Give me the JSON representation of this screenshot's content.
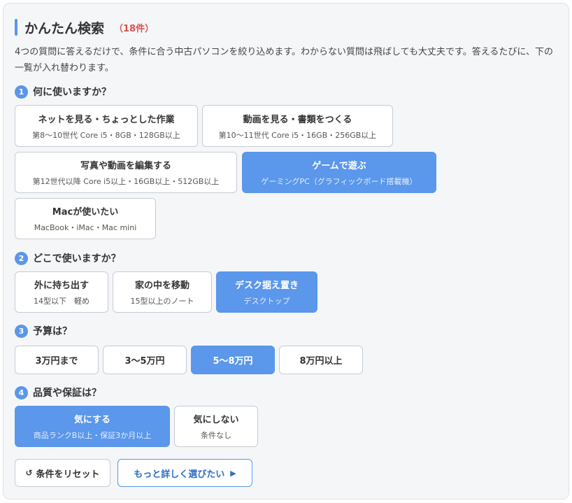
{
  "header": {
    "title": "かんたん検索",
    "count": "（18件）"
  },
  "description": "4つの質問に答えるだけで、条件に合う中古パソコンを絞り込めます。わからない質問は飛ばしても大丈夫です。答えるたびに、下の一覧が入れ替わります。",
  "questions": [
    {
      "num": "1",
      "label": "何に使いますか？",
      "options": [
        {
          "main": "ネットを見る・ちょっとした作業",
          "sub": "第8〜10世代 Core i5・8GB・128GB以上",
          "selected": false
        },
        {
          "main": "動画を見る・書類をつくる",
          "sub": "第10〜11世代 Core i5・16GB・256GB以上",
          "selected": false
        },
        {
          "main": "写真や動画を編集する",
          "sub": "第12世代以降 Core i5以上・16GB以上・512GB以上",
          "selected": false
        },
        {
          "main": "ゲームで遊ぶ",
          "sub": "ゲーミングPC（グラフィックボード搭載機）",
          "selected": true
        },
        {
          "main": "Macが使いたい",
          "sub": "MacBook・iMac・Mac mini",
          "selected": false
        }
      ]
    },
    {
      "num": "2",
      "label": "どこで使いますか？",
      "options": [
        {
          "main": "外に持ち出す",
          "sub": "14型以下　軽め",
          "selected": false
        },
        {
          "main": "家の中を移動",
          "sub": "15型以上のノート",
          "selected": false
        },
        {
          "main": "デスク据え置き",
          "sub": "デスクトップ",
          "selected": true
        }
      ]
    },
    {
      "num": "3",
      "label": "予算は？",
      "options": [
        {
          "main": "3万円まで",
          "selected": false
        },
        {
          "main": "3〜5万円",
          "selected": false
        },
        {
          "main": "5〜8万円",
          "selected": true
        },
        {
          "main": "8万円以上",
          "selected": false
        }
      ]
    },
    {
      "num": "4",
      "label": "品質や保証は？",
      "options": [
        {
          "main": "気にする",
          "sub": "商品ランクB以上・保証3か月以上",
          "selected": true
        },
        {
          "main": "気にしない",
          "sub": "条件なし",
          "selected": false
        }
      ]
    }
  ],
  "actions": {
    "reset_icon": "reset-arrow-icon",
    "reset_label": "条件をリセット",
    "more_label": "もっと詳しく選びたい",
    "more_icon": "play-icon"
  },
  "colors": {
    "accent": "#5b97ea",
    "count": "#d9534f",
    "panel_bg": "#f5f6f8"
  }
}
